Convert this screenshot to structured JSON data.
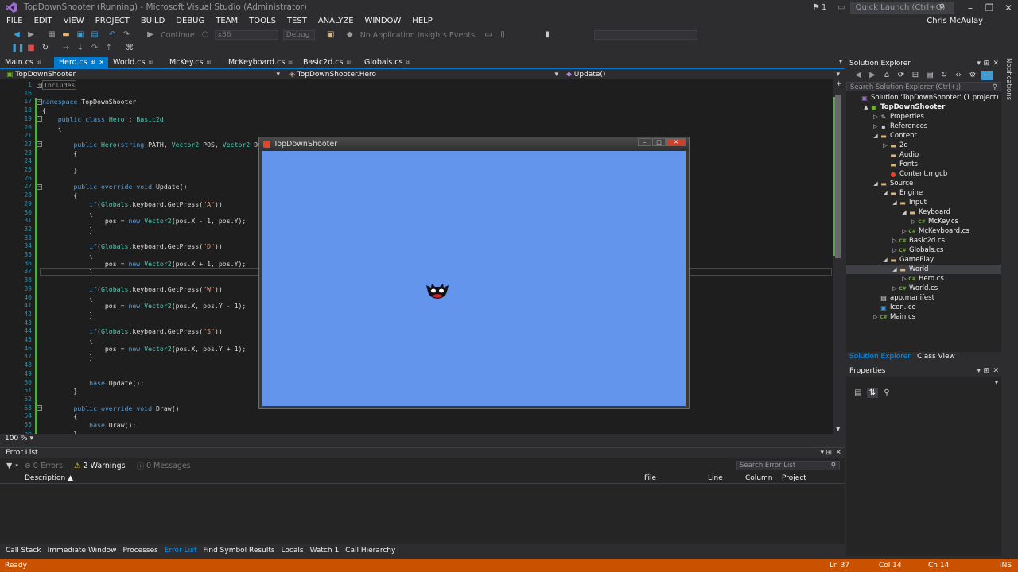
{
  "window": {
    "title": "TopDownShooter (Running) - Microsoft Visual Studio (Administrator)",
    "notification_count": "1",
    "quick_launch_placeholder": "Quick Launch (Ctrl+Q)"
  },
  "menu": {
    "items": [
      "FILE",
      "EDIT",
      "VIEW",
      "PROJECT",
      "BUILD",
      "DEBUG",
      "TEAM",
      "TOOLS",
      "TEST",
      "ANALYZE",
      "WINDOW",
      "HELP"
    ],
    "user": "Chris McAulay"
  },
  "toolbar": {
    "continue_label": "Continue",
    "platform": "x86",
    "config": "Debug",
    "insights": "No Application Insights Events"
  },
  "tabs": [
    "Main.cs",
    "Hero.cs",
    "World.cs",
    "McKey.cs",
    "McKeyboard.cs",
    "Basic2d.cs",
    "Globals.cs"
  ],
  "active_tab": "Hero.cs",
  "navbar": {
    "project": "TopDownShooter",
    "type": "TopDownShooter.Hero",
    "member": "Update()"
  },
  "editor": {
    "zoom": "100 %",
    "lines": [
      {
        "n": "1",
        "t": "includes"
      },
      {
        "n": "16",
        "t": ""
      },
      {
        "n": "17",
        "t": "namespace TopDownShooter"
      },
      {
        "n": "18",
        "t": "{"
      },
      {
        "n": "19",
        "t": "    public class Hero : Basic2d"
      },
      {
        "n": "20",
        "t": "    {"
      },
      {
        "n": "21",
        "t": ""
      },
      {
        "n": "22",
        "t": "        public Hero(string PATH, Vector2 POS, Vector2 DIMS"
      },
      {
        "n": "23",
        "t": "        {"
      },
      {
        "n": "24",
        "t": ""
      },
      {
        "n": "25",
        "t": "        }"
      },
      {
        "n": "26",
        "t": ""
      },
      {
        "n": "27",
        "t": "        public override void Update()"
      },
      {
        "n": "28",
        "t": "        {"
      },
      {
        "n": "29",
        "t": "            if(Globals.keyboard.GetPress(\"A\"))"
      },
      {
        "n": "30",
        "t": "            {"
      },
      {
        "n": "31",
        "t": "                pos = new Vector2(pos.X - 1, pos.Y);"
      },
      {
        "n": "32",
        "t": "            }"
      },
      {
        "n": "33",
        "t": ""
      },
      {
        "n": "34",
        "t": "            if(Globals.keyboard.GetPress(\"D\"))"
      },
      {
        "n": "35",
        "t": "            {"
      },
      {
        "n": "36",
        "t": "                pos = new Vector2(pos.X + 1, pos.Y);"
      },
      {
        "n": "37",
        "t": "            }"
      },
      {
        "n": "38",
        "t": ""
      },
      {
        "n": "39",
        "t": "            if(Globals.keyboard.GetPress(\"W\"))"
      },
      {
        "n": "40",
        "t": "            {"
      },
      {
        "n": "41",
        "t": "                pos = new Vector2(pos.X, pos.Y - 1);"
      },
      {
        "n": "42",
        "t": "            }"
      },
      {
        "n": "43",
        "t": ""
      },
      {
        "n": "44",
        "t": "            if(Globals.keyboard.GetPress(\"S\"))"
      },
      {
        "n": "45",
        "t": "            {"
      },
      {
        "n": "46",
        "t": "                pos = new Vector2(pos.X, pos.Y + 1);"
      },
      {
        "n": "47",
        "t": "            }"
      },
      {
        "n": "48",
        "t": ""
      },
      {
        "n": "49",
        "t": ""
      },
      {
        "n": "50",
        "t": "            base.Update();"
      },
      {
        "n": "51",
        "t": "        }"
      },
      {
        "n": "52",
        "t": ""
      },
      {
        "n": "53",
        "t": "        public override void Draw()"
      },
      {
        "n": "54",
        "t": "        {"
      },
      {
        "n": "55",
        "t": "            base.Draw();"
      },
      {
        "n": "56",
        "t": "        }"
      }
    ],
    "includes_label": "Includes"
  },
  "game_window": {
    "title": "TopDownShooter",
    "background": "#6495ED"
  },
  "error_list": {
    "title": "Error List",
    "errors": "0 Errors",
    "warnings": "2 Warnings",
    "messages": "0 Messages",
    "search_placeholder": "Search Error List",
    "columns": [
      "Description",
      "File",
      "Line",
      "Column",
      "Project"
    ]
  },
  "bottom_tabs": [
    "Call Stack",
    "Immediate Window",
    "Processes",
    "Error List",
    "Find Symbol Results",
    "Locals",
    "Watch 1",
    "Call Hierarchy"
  ],
  "active_bottom_tab": "Error List",
  "solution_explorer": {
    "title": "Solution Explorer",
    "search_placeholder": "Search Solution Explorer (Ctrl+;)",
    "tree": [
      {
        "label": "Solution 'TopDownShooter' (1 project)",
        "icon": "solution-icon",
        "depth": 0,
        "arrow": ""
      },
      {
        "label": "TopDownShooter",
        "icon": "project-icon",
        "depth": 1,
        "arrow": "▲",
        "bold": true
      },
      {
        "label": "Properties",
        "icon": "wrench-icon",
        "depth": 2,
        "arrow": "▷"
      },
      {
        "label": "References",
        "icon": "references-icon",
        "depth": 2,
        "arrow": "▷"
      },
      {
        "label": "Content",
        "icon": "folder-icon",
        "depth": 2,
        "arrow": "◢"
      },
      {
        "label": "2d",
        "icon": "folder-icon",
        "depth": 3,
        "arrow": "▷"
      },
      {
        "label": "Audio",
        "icon": "folder-icon",
        "depth": 3,
        "arrow": ""
      },
      {
        "label": "Fonts",
        "icon": "folder-icon",
        "depth": 3,
        "arrow": ""
      },
      {
        "label": "Content.mgcb",
        "icon": "mgcb-icon",
        "depth": 3,
        "arrow": ""
      },
      {
        "label": "Source",
        "icon": "folder-icon",
        "depth": 2,
        "arrow": "◢"
      },
      {
        "label": "Engine",
        "icon": "folder-icon",
        "depth": 3,
        "arrow": "◢"
      },
      {
        "label": "Input",
        "icon": "folder-icon",
        "depth": 4,
        "arrow": "◢"
      },
      {
        "label": "Keyboard",
        "icon": "folder-icon",
        "depth": 5,
        "arrow": "◢"
      },
      {
        "label": "McKey.cs",
        "icon": "csharp-icon",
        "depth": 6,
        "arrow": "▷"
      },
      {
        "label": "McKeyboard.cs",
        "icon": "csharp-icon",
        "depth": 5,
        "arrow": "▷"
      },
      {
        "label": "Basic2d.cs",
        "icon": "csharp-icon",
        "depth": 4,
        "arrow": "▷"
      },
      {
        "label": "Globals.cs",
        "icon": "csharp-icon",
        "depth": 4,
        "arrow": "▷"
      },
      {
        "label": "GamePlay",
        "icon": "folder-icon",
        "depth": 3,
        "arrow": "◢"
      },
      {
        "label": "World",
        "icon": "folder-icon",
        "depth": 4,
        "arrow": "◢",
        "selected": true
      },
      {
        "label": "Hero.cs",
        "icon": "csharp-icon",
        "depth": 5,
        "arrow": "▷"
      },
      {
        "label": "World.cs",
        "icon": "csharp-icon",
        "depth": 4,
        "arrow": "▷"
      },
      {
        "label": "app.manifest",
        "icon": "manifest-icon",
        "depth": 2,
        "arrow": ""
      },
      {
        "label": "Icon.ico",
        "icon": "ico-icon",
        "depth": 2,
        "arrow": ""
      },
      {
        "label": "Main.cs",
        "icon": "csharp-icon",
        "depth": 2,
        "arrow": "▷"
      }
    ],
    "bottom_tabs": [
      "Solution Explorer",
      "Class View"
    ]
  },
  "properties": {
    "title": "Properties"
  },
  "notifications_label": "Notifications",
  "status": {
    "state": "Ready",
    "ln": "Ln 37",
    "col": "Col 14",
    "ch": "Ch 14",
    "mode": "INS",
    "color": "#CA5100"
  }
}
